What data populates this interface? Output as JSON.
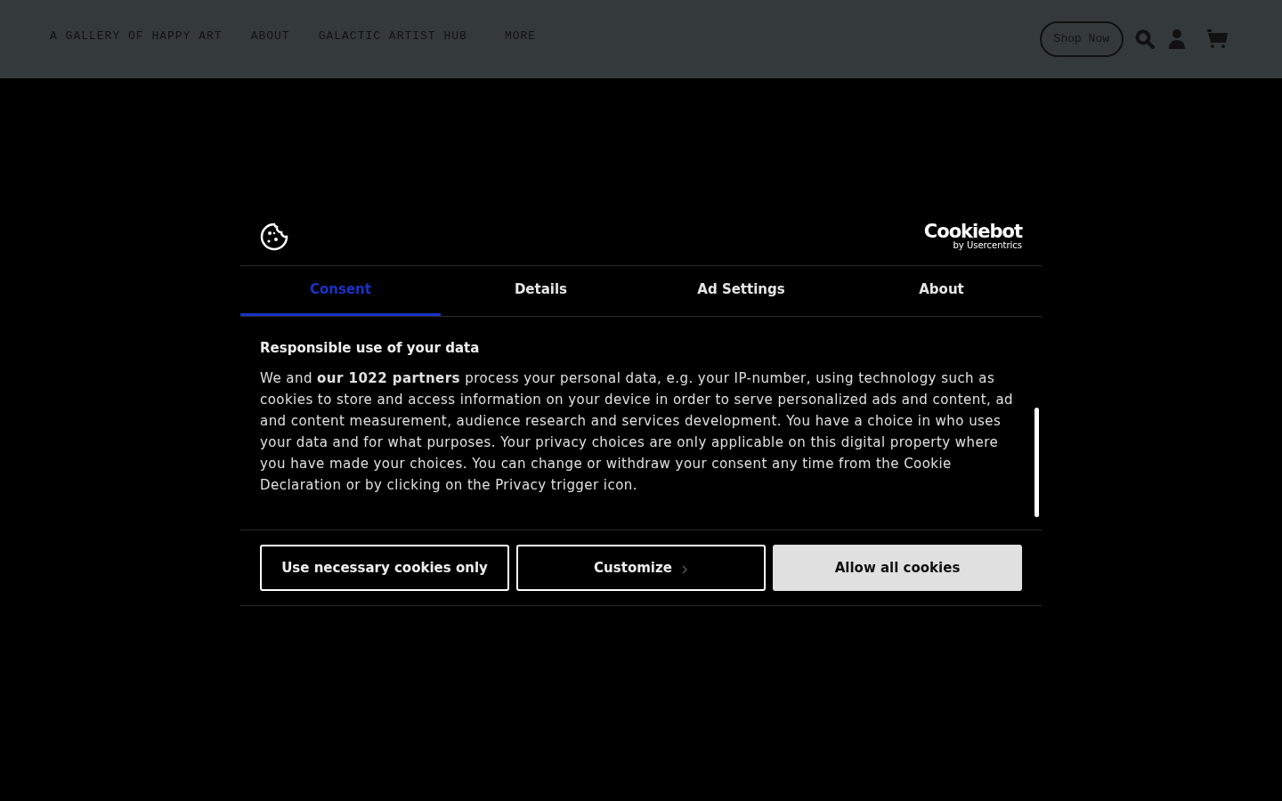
{
  "nav": {
    "links": [
      "A GALLERY OF HAPPY ART",
      "ABOUT",
      "GALACTIC ARTIST HUB",
      "MORE"
    ],
    "shop_button": "Shop Now"
  },
  "dialog": {
    "logo": {
      "name": "Cookiebot",
      "tagline": "by Usercentrics"
    },
    "tabs": [
      {
        "label": "Consent",
        "selected": true
      },
      {
        "label": "Details",
        "selected": false
      },
      {
        "label": "Ad Settings",
        "selected": false
      },
      {
        "label": "About",
        "selected": false
      }
    ],
    "heading": "Responsible use of your data",
    "body": "We and **our 1022 partners** process your personal data, e.g. your IP-number, using technology such as cookies to store and access information on your device in order to serve personalized ads and content, ad and content measurement, audience research and services development. You have a choice in who uses your data and for what purposes. Your privacy choices are only applicable on this digital property where you have made your choices. You can change or withdraw your consent any time from the Cookie Declaration or by clicking on the Privacy trigger icon.",
    "buttons": [
      {
        "label": "Use necessary cookies only",
        "kind": "outline"
      },
      {
        "label": "Customize",
        "kind": "chevron"
      },
      {
        "label": "Allow all cookies",
        "kind": "filled"
      }
    ]
  }
}
